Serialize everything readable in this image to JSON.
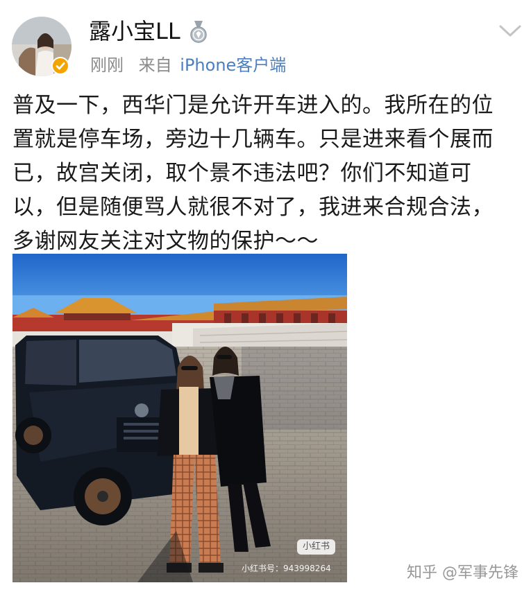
{
  "header": {
    "username": "露小宝LL",
    "time": "刚刚",
    "source_prefix": "来自",
    "source_app": "iPhone客户端",
    "avatar_icon": "user-avatar",
    "verified_icon": "verified-check-icon",
    "medal_icon": "medal-icon",
    "menu_icon": "chevron-down-icon"
  },
  "post": {
    "lines": [
      "普及一下，西华门是允许开车进入的。我所在的位",
      "置就是停车场，旁边十几辆车。只是进来看个展而",
      "已，故宫关闭，取个景不违法吧？你们不知道可",
      "以，但是随便骂人就很不对了，我进来合规合法，",
      "多谢网友关注对文物的保护～～"
    ]
  },
  "photo": {
    "subject": "photo-two-women-with-black-suv-in-palace-courtyard",
    "watermark_badge": "小红书",
    "watermark_id": "小红书号：943998264"
  },
  "page_watermark": "知乎 @军事先锋",
  "colors": {
    "link": "#4b7fbf",
    "meta_gray": "#8a8a8a",
    "verified_orange": "#f3a400",
    "text": "#1a1a1a"
  }
}
